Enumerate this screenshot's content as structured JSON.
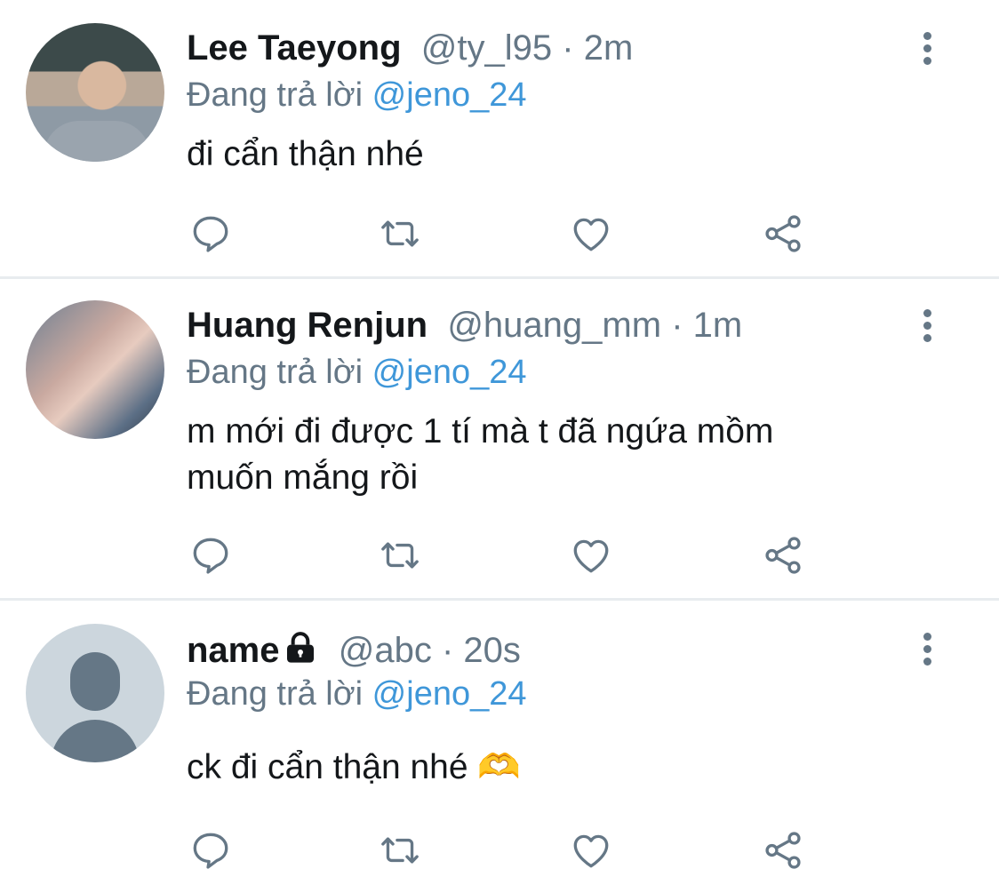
{
  "tweets": [
    {
      "name": "Lee Taeyong",
      "handle": "@ty_l95",
      "time": "2m",
      "reply_prefix": "Đang trả lời",
      "reply_to": "@jeno_24",
      "text": "đi cẩn thận nhé",
      "avatar": "profile-photo"
    },
    {
      "name": "Huang Renjun",
      "handle": "@huang_mm",
      "time": "1m",
      "reply_prefix": "Đang trả lời",
      "reply_to": "@jeno_24",
      "text": "m mới đi được 1 tí mà t đã ngứa mồm muốn mắng rồi",
      "avatar": "profile-photo"
    },
    {
      "name": "name",
      "handle": "@abc",
      "time": "20s",
      "reply_prefix": "Đang trả lời",
      "reply_to": "@jeno_24",
      "text": "ck đi cẩn thận nhé 🫶",
      "avatar": "default-avatar",
      "locked": true
    }
  ],
  "separator": "·",
  "icons": [
    "reply-icon",
    "retweet-icon",
    "like-icon",
    "share-icon",
    "more-icon",
    "lock-icon"
  ],
  "colors": {
    "mention": "#3f97d9",
    "muted": "#657786",
    "text": "#14171a",
    "divider": "#e8ecef"
  }
}
